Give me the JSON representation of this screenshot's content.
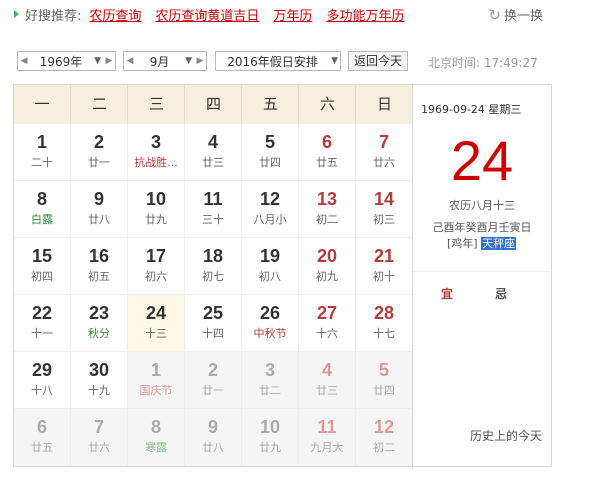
{
  "recommend": {
    "label": "好搜推荐:",
    "links": [
      "农历查询",
      "农历查询黄道吉日",
      "万年历",
      "多功能万年历"
    ],
    "refresh_label": "换一换"
  },
  "toolbar": {
    "year": "1969年",
    "month": "9月",
    "holiday": "2016年假日安排",
    "today_button": "返回今天",
    "beijing_time": "北京时间: 17:49:27"
  },
  "weekdays": [
    "一",
    "二",
    "三",
    "四",
    "五",
    "六",
    "日"
  ],
  "days": [
    {
      "d": "1",
      "l": "二十"
    },
    {
      "d": "2",
      "l": "廿一"
    },
    {
      "d": "3",
      "l": "抗战胜...",
      "t": "fest"
    },
    {
      "d": "4",
      "l": "廿三"
    },
    {
      "d": "5",
      "l": "廿四"
    },
    {
      "d": "6",
      "l": "廿五"
    },
    {
      "d": "7",
      "l": "廿六"
    },
    {
      "d": "8",
      "l": "白露",
      "t": "term"
    },
    {
      "d": "9",
      "l": "廿八"
    },
    {
      "d": "10",
      "l": "廿九"
    },
    {
      "d": "11",
      "l": "三十"
    },
    {
      "d": "12",
      "l": "八月小"
    },
    {
      "d": "13",
      "l": "初二"
    },
    {
      "d": "14",
      "l": "初三"
    },
    {
      "d": "15",
      "l": "初四"
    },
    {
      "d": "16",
      "l": "初五"
    },
    {
      "d": "17",
      "l": "初六"
    },
    {
      "d": "18",
      "l": "初七"
    },
    {
      "d": "19",
      "l": "初八"
    },
    {
      "d": "20",
      "l": "初九"
    },
    {
      "d": "21",
      "l": "初十"
    },
    {
      "d": "22",
      "l": "十一"
    },
    {
      "d": "23",
      "l": "秋分",
      "t": "term"
    },
    {
      "d": "24",
      "l": "十三",
      "today": true
    },
    {
      "d": "25",
      "l": "十四"
    },
    {
      "d": "26",
      "l": "中秋节",
      "t": "fest"
    },
    {
      "d": "27",
      "l": "十六"
    },
    {
      "d": "28",
      "l": "十七"
    },
    {
      "d": "29",
      "l": "十八"
    },
    {
      "d": "30",
      "l": "十九"
    },
    {
      "d": "1",
      "l": "国庆节",
      "t": "fest",
      "other": true
    },
    {
      "d": "2",
      "l": "廿一",
      "other": true
    },
    {
      "d": "3",
      "l": "廿二",
      "other": true
    },
    {
      "d": "4",
      "l": "廿三",
      "other": true
    },
    {
      "d": "5",
      "l": "廿四",
      "other": true
    },
    {
      "d": "6",
      "l": "廿五",
      "other": true
    },
    {
      "d": "7",
      "l": "廿六",
      "other": true
    },
    {
      "d": "8",
      "l": "寒露",
      "t": "term",
      "other": true
    },
    {
      "d": "9",
      "l": "廿八",
      "other": true
    },
    {
      "d": "10",
      "l": "廿九",
      "other": true
    },
    {
      "d": "11",
      "l": "九月大",
      "other": true
    },
    {
      "d": "12",
      "l": "初二",
      "other": true
    }
  ],
  "side": {
    "date": "1969-09-24  星期三",
    "big_day": "24",
    "lunar": "农历八月十三",
    "ganzhi": "己酉年癸酉月壬寅日",
    "zodiac": "[鸡年]",
    "star": "天秤座",
    "yi": "宜",
    "ji": "忌",
    "history": "历史上的今天"
  },
  "colors": {
    "weekend": "#b53b3b",
    "accent": "#cc0000",
    "header_bg": "#f5f0de",
    "today_bg": "#fff8e5"
  }
}
